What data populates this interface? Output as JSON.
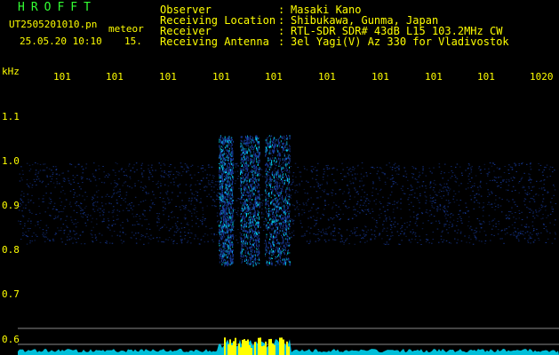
{
  "header": {
    "title": "HROFFT",
    "filename": "UT2505201010.pn",
    "type": "meteor",
    "datetime": "25.05.20 10:10",
    "frame": "15."
  },
  "info": [
    {
      "label": "Observer",
      "value": "Masaki Kano"
    },
    {
      "label": "Receiving Location",
      "value": "Shibukawa, Gunma, Japan"
    },
    {
      "label": "Receiver",
      "value": "RTL-SDR SDR# 43dB L15 103.2MHz CW"
    },
    {
      "label": "Receiving Antenna",
      "value": "3el Yagi(V) Az 330 for Vladivostok"
    }
  ],
  "separator": ":",
  "axis": {
    "unit": "kHz",
    "x_ticks": [
      "101",
      "101",
      "101",
      "101",
      "101",
      "101",
      "101",
      "101",
      "101",
      "1020"
    ],
    "y_ticks": [
      "1.1",
      "1.0",
      "0.9",
      "0.8",
      "0.7",
      "0.6"
    ]
  },
  "colors": {
    "background": "#000000",
    "text": "#ffff00",
    "title": "#33ff33",
    "noise_band": "#1a3fa8",
    "signal": "#00e0ff",
    "spectrum": "#00e0ff",
    "peak": "#ffff00"
  }
}
